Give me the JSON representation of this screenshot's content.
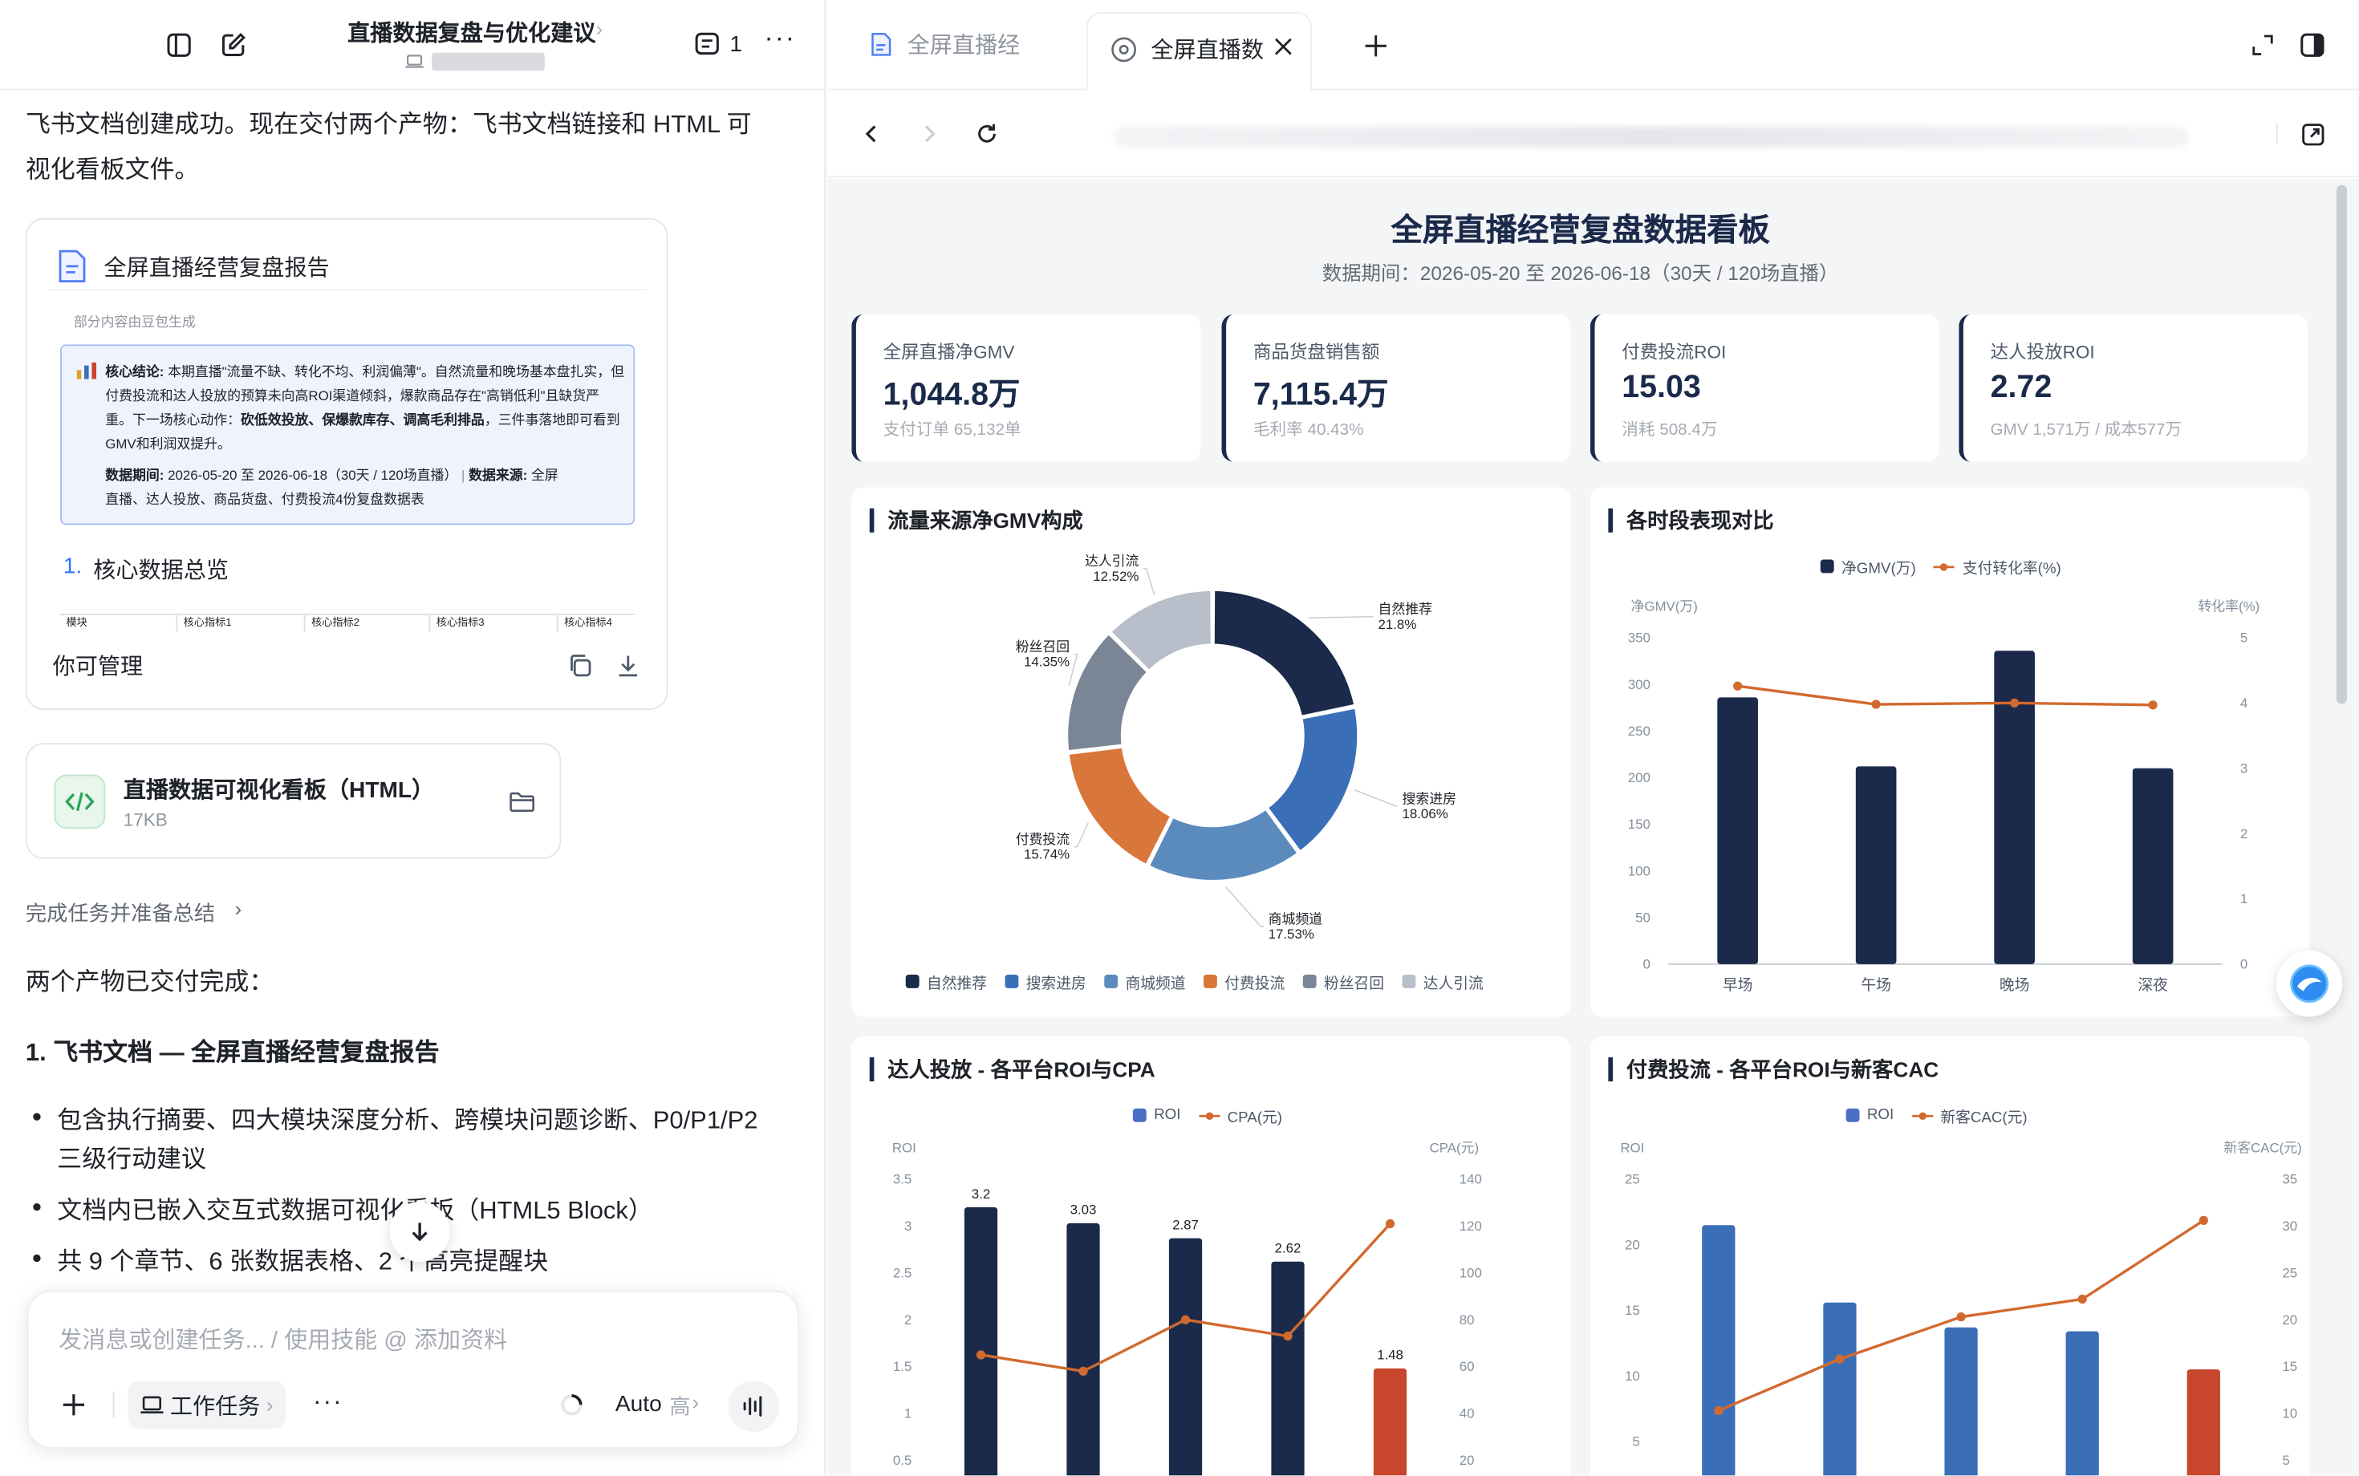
{
  "left": {
    "doc_title": "直播数据复盘与优化建议",
    "badge_count": "1",
    "intro": [
      "飞书文档创建成功。现在交付两个产物：飞书文档链接和 HTML 可",
      "视化看板文件。"
    ],
    "doc_card": {
      "title": "全屏直播经营复盘报告",
      "ai_note": "部分内容由豆包生成",
      "summary_label": "核心结论:",
      "summary_lines": [
        "本期直播\"流量不缺、转化不均、利润偏薄\"。自然流量和晚场基本",
        "盘扎实，但付费投流和达人投放的预算未向高ROI渠道倾斜，爆款商品存在\"高",
        "销低利\"且缺货严重。下一场核心动作：",
        "砍低效投放、保爆款库存、调高毛利排",
        "品",
        "，三件事落地即可看到GMV和利润双提升。"
      ],
      "period_label": "数据期间:",
      "period_value": "2026-05-20 至 2026-06-18（30天 / 120场直播）",
      "source_label": "数据来源:",
      "source_value": "全屏",
      "source_line2": "直播、达人投放、商品货盘、付费投流4份复盘数据表",
      "section_num": "1.",
      "section_title": "核心数据总览",
      "table_headers": [
        "模块",
        "核心指标1",
        "核心指标2",
        "核心指标3",
        "核心指标4"
      ],
      "permission": "你可管理"
    },
    "file_card": {
      "title": "直播数据可视化看板（HTML）",
      "size": "17KB"
    },
    "task_link": "完成任务并准备总结",
    "done_text": "两个产物已交付完成：",
    "heading1": "1. 飞书文档 — 全屏直播经营复盘报告",
    "bullets": [
      "包含执行摘要、四大模块深度分析、跨模块问题诊断、P0/P1/P2",
      "三级行动建议",
      "文档内已嵌入交互式数据可视化看板（HTML5 Block）",
      "共 9 个章节、6 张数据表格、2 个高亮提醒块"
    ],
    "input_placeholder": "发消息或创建任务... / 使用技能 @ 添加资料",
    "work_task": "工作任务",
    "model": "Auto",
    "model_level": "高"
  },
  "right": {
    "tabs": [
      {
        "label": "全屏直播经"
      },
      {
        "label": "全屏直播数"
      }
    ],
    "dashboard_title": "全屏直播经营复盘数据看板",
    "dashboard_subtitle": "数据期间：2026-05-20 至 2026-06-18（30天 / 120场直播）",
    "kpis": [
      {
        "label": "全屏直播净GMV",
        "value": "1,044.8万",
        "sub": "支付订单 65,132单"
      },
      {
        "label": "商品货盘销售额",
        "value": "7,115.4万",
        "sub": "毛利率 40.43%"
      },
      {
        "label": "付费投流ROI",
        "value": "15.03",
        "sub": "消耗 508.4万"
      },
      {
        "label": "达人投放ROI",
        "value": "2.72",
        "sub": "GMV 1,571万 / 成本577万"
      }
    ],
    "colors": {
      "navy": "#1b2a4a",
      "blue": "#3a6fb8",
      "steel": "#5b8bbd",
      "orange": "#d9763a",
      "slate": "#7a8596",
      "silver": "#b9bfca",
      "red": "#c8462b",
      "line": "#d2692e"
    }
  },
  "chart_data": [
    {
      "type": "pie",
      "title": "流量来源净GMV构成",
      "categories": [
        "自然推荐",
        "搜索进房",
        "商城频道",
        "付费投流",
        "粉丝召回",
        "达人引流"
      ],
      "values": [
        21.8,
        18.06,
        17.53,
        15.74,
        14.35,
        12.52
      ],
      "labels": [
        "21.8%",
        "18.06%",
        "17.53%",
        "15.74%",
        "14.35%",
        "12.52%"
      ],
      "legend": "bottom"
    },
    {
      "type": "bar",
      "title": "各时段表现对比",
      "categories": [
        "早场",
        "午场",
        "晚场",
        "深夜"
      ],
      "series": [
        {
          "name": "净GMV(万)",
          "values": [
            286,
            212,
            336,
            210
          ]
        },
        {
          "name": "支付转化率(%)",
          "values": [
            4.26,
            3.98,
            4.0,
            3.97
          ]
        }
      ],
      "ylabel": "净GMV(万)",
      "y2label": "转化率(%)",
      "ylim": [
        0,
        350
      ],
      "y2lim": [
        0,
        5
      ],
      "yticks": [
        "0",
        "50",
        "100",
        "150",
        "200",
        "250",
        "300",
        "350"
      ],
      "y2ticks": [
        "0",
        "1",
        "2",
        "3",
        "4",
        "5"
      ],
      "legend": "top"
    },
    {
      "type": "bar",
      "title": "达人投放 - 各平台ROI与CPA",
      "series": [
        {
          "name": "ROI",
          "values": [
            3.2,
            3.03,
            2.87,
            2.62,
            1.48
          ],
          "labels": [
            "3.2",
            "3.03",
            "2.87",
            "2.62",
            "1.48"
          ]
        },
        {
          "name": "CPA(元)",
          "values": [
            65,
            58,
            80,
            73,
            121
          ]
        }
      ],
      "ylabel": "ROI",
      "y2label": "CPA(元)",
      "ylim": [
        0,
        3.5
      ],
      "y2lim": [
        0,
        140
      ],
      "yticks": [
        "0.5",
        "1",
        "1.5",
        "2",
        "2.5",
        "3",
        "3.5"
      ],
      "y2ticks": [
        "20",
        "40",
        "60",
        "80",
        "100",
        "120",
        "140"
      ],
      "legend": "top"
    },
    {
      "type": "bar",
      "title": "付费投流 - 各平台ROI与新客CAC",
      "series": [
        {
          "name": "ROI",
          "values": [
            21.5,
            15.6,
            13.7,
            13.4,
            10.5
          ]
        },
        {
          "name": "新客CAC(元)",
          "values": [
            10.3,
            15.8,
            20.3,
            22.2,
            30.6
          ]
        }
      ],
      "ylabel": "ROI",
      "y2label": "新客CAC(元)",
      "ylim": [
        0,
        25
      ],
      "y2lim": [
        0,
        35
      ],
      "yticks": [
        "5",
        "10",
        "15",
        "20",
        "25"
      ],
      "y2ticks": [
        "5",
        "10",
        "15",
        "20",
        "25",
        "30",
        "35"
      ],
      "legend": "top"
    }
  ]
}
